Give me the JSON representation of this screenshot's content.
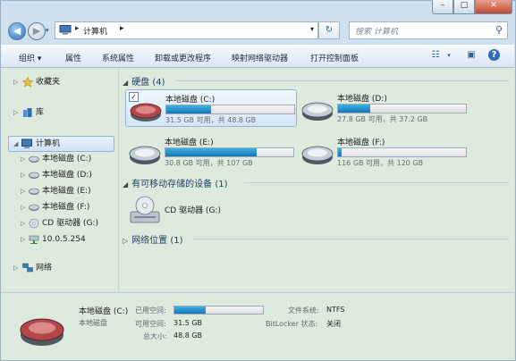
{
  "address": {
    "location": "计算机",
    "separator": "▸",
    "dropdown": "▾"
  },
  "search": {
    "placeholder": "搜索 计算机"
  },
  "toolbar": {
    "organize": "组织 ▾",
    "properties": "属性",
    "system_properties": "系统属性",
    "uninstall": "卸载或更改程序",
    "map_drive": "映射网络驱动器",
    "control_panel": "打开控制面板"
  },
  "sidebar": {
    "favorites": "收藏夹",
    "libraries": "库",
    "computer": "计算机",
    "drives": [
      "本地磁盘 (C:)",
      "本地磁盘 (D:)",
      "本地磁盘 (E:)",
      "本地磁盘 (F:)"
    ],
    "cd": "CD 驱动器 (G:)",
    "net_share": "10.0.5.254",
    "network": "网络"
  },
  "groups": {
    "hdd": "硬盘 (4)",
    "removable": "有可移动存储的设备 (1)",
    "network": "网络位置 (1)"
  },
  "drives": [
    {
      "name": "本地磁盘 (C:)",
      "info": "31.5 GB 可用，共 48.8 GB",
      "used_fraction": 0.35,
      "checked": "✓"
    },
    {
      "name": "本地磁盘 (D:)",
      "info": "27.8 GB 可用，共 37.2 GB",
      "used_fraction": 0.25
    },
    {
      "name": "本地磁盘 (E:)",
      "info": "30.8 GB 可用，共 107 GB",
      "used_fraction": 0.71
    },
    {
      "name": "本地磁盘 (F:)",
      "info": "116 GB 可用，共 120 GB",
      "used_fraction": 0.03
    }
  ],
  "cd_drive": {
    "name": "CD 驱动器 (G:)"
  },
  "details": {
    "name": "本地磁盘 (C:)",
    "type": "本地磁盘",
    "used_label": "已用空间:",
    "free_label": "可用空间:",
    "free_value": "31.5 GB",
    "total_label": "总大小:",
    "total_value": "48.8 GB",
    "fs_label": "文件系统:",
    "fs_value": "NTFS",
    "bitlocker_label": "BitLocker 状态:",
    "bitlocker_value": "关闭",
    "used_fraction": 0.35
  }
}
